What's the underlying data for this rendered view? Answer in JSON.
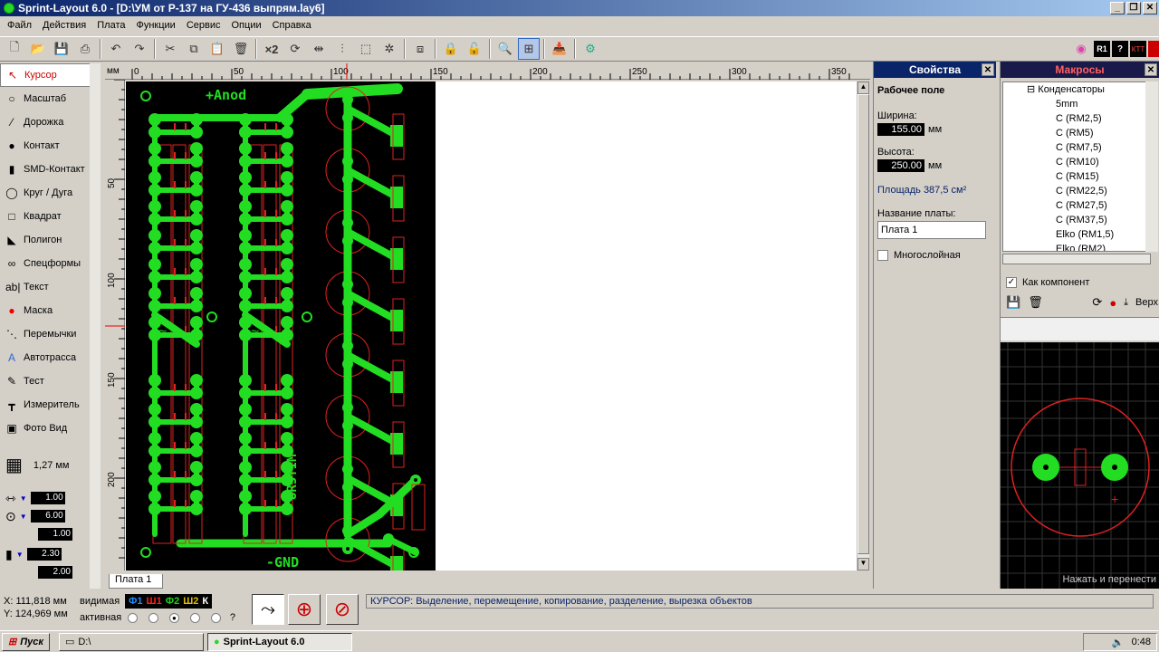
{
  "window": {
    "title": "Sprint-Layout 6.0 - [D:\\УМ от Р-137 на ГУ-436 выпрям.lay6]"
  },
  "menu": [
    "Файл",
    "Действия",
    "Плата",
    "Функции",
    "Сервис",
    "Опции",
    "Справка"
  ],
  "tools": [
    {
      "label": "Курсор",
      "icon": "cursor-icon",
      "glyph": "↖"
    },
    {
      "label": "Масштаб",
      "icon": "zoom-icon",
      "glyph": "○"
    },
    {
      "label": "Дорожка",
      "icon": "track-icon",
      "glyph": "⁄"
    },
    {
      "label": "Контакт",
      "icon": "pad-icon",
      "glyph": "●"
    },
    {
      "label": "SMD-Контакт",
      "icon": "smd-icon",
      "glyph": "▮"
    },
    {
      "label": "Круг / Дуга",
      "icon": "circle-icon",
      "glyph": "◯"
    },
    {
      "label": "Квадрат",
      "icon": "square-icon",
      "glyph": "□"
    },
    {
      "label": "Полигон",
      "icon": "polygon-icon",
      "glyph": "◣"
    },
    {
      "label": "Спецформы",
      "icon": "specforms-icon",
      "glyph": "∞"
    },
    {
      "label": "Текст",
      "icon": "text-icon",
      "glyph": "ab|"
    },
    {
      "label": "Маска",
      "icon": "mask-icon",
      "glyph": "●"
    },
    {
      "label": "Перемычки",
      "icon": "jumper-icon",
      "glyph": "⋱"
    },
    {
      "label": "Автотрасса",
      "icon": "autoroute-icon",
      "glyph": "A"
    },
    {
      "label": "Тест",
      "icon": "test-icon",
      "glyph": "✎"
    },
    {
      "label": "Измеритель",
      "icon": "measure-icon",
      "glyph": "┳"
    },
    {
      "label": "Фото Вид",
      "icon": "photo-icon",
      "glyph": "▣"
    }
  ],
  "grid": {
    "value": "1,27 мм"
  },
  "params": {
    "track_width": "1.00",
    "pad_outer": "6.00",
    "pad_inner": "1.00",
    "smd_w": "2.30",
    "smd_h": "2.00"
  },
  "ruler": {
    "unit": "мм",
    "h": [
      "0",
      "50",
      "100",
      "150",
      "200",
      "250",
      "300",
      "350"
    ],
    "v": [
      "50",
      "100",
      "150",
      "200"
    ]
  },
  "board": {
    "anod": "+Anod",
    "gnd": "-GND",
    "sign": "UR5YIM",
    "tilde": "~"
  },
  "page_tab": "Плата 1",
  "props": {
    "title": "Свойства",
    "section": "Рабочее поле",
    "width_label": "Ширина:",
    "width_value": "155.00",
    "unit": "мм",
    "height_label": "Высота:",
    "height_value": "250.00",
    "area": "Площадь 387,5 см²",
    "name_label": "Название платы:",
    "name_value": "Плата 1",
    "multilayer": "Многослойная"
  },
  "macros": {
    "title": "Макросы",
    "tree_root": "Конденсаторы",
    "items": [
      "5mm",
      "C (RM2,5)",
      "C (RM5)",
      "C (RM7,5)",
      "C (RM10)",
      "C (RM15)",
      "C (RM22,5)",
      "C (RM27,5)",
      "C (RM37,5)",
      "Elko (RM1,5)",
      "Elko (RM2)"
    ],
    "as_component": "Как компонент",
    "top": "Верх",
    "hint": "Нажать и перенести"
  },
  "status": {
    "x": "X:  111,818 мм",
    "y": "Y:  124,969 мм",
    "visible": "видимая",
    "active": "активная",
    "layers": [
      {
        "n": "Ф1",
        "c": "#1e90ff"
      },
      {
        "n": "Ш1",
        "c": "#ff2020"
      },
      {
        "n": "Ф2",
        "c": "#20d020"
      },
      {
        "n": "Ш2",
        "c": "#e0c000"
      },
      {
        "n": "К",
        "c": "#ffffff"
      }
    ],
    "q": "?",
    "message": "КУРСОР: Выделение, перемещение, копирование, разделение, вырезка объектов"
  },
  "taskbar": {
    "start": "Пуск",
    "drive": "D:\\",
    "app": "Sprint-Layout 6.0",
    "clock": "0:48"
  },
  "colors": {
    "copper": "#22dd22",
    "silk": "#dd2222",
    "board": "#000000",
    "title": "#0a246a"
  }
}
